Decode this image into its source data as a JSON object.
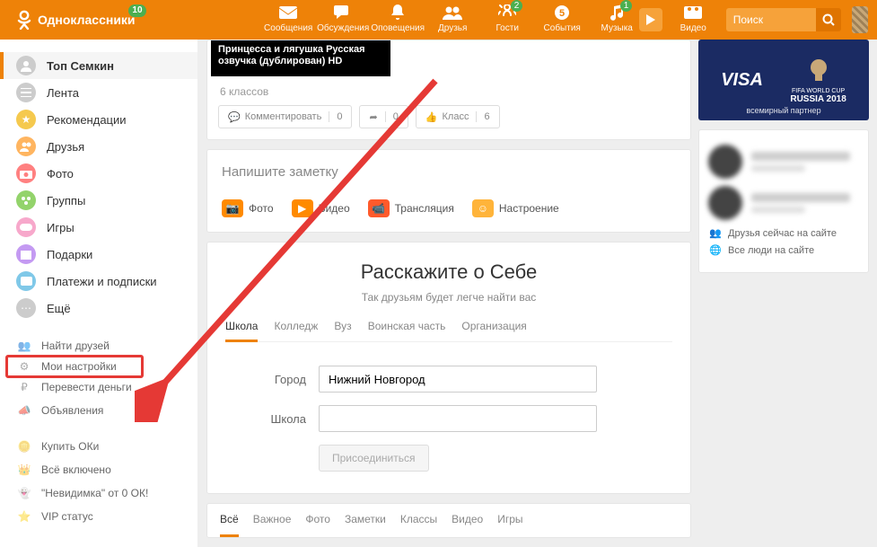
{
  "header": {
    "site": "Одноклассники",
    "notif": "10",
    "nav": [
      {
        "label": "Сообщения"
      },
      {
        "label": "Обсуждения"
      },
      {
        "label": "Оповещения"
      },
      {
        "label": "Друзья"
      },
      {
        "label": "Гости",
        "badge": "2"
      },
      {
        "label": "События"
      },
      {
        "label": "Музыка",
        "badge": "1"
      },
      {
        "label": "Видео"
      }
    ],
    "search_ph": "Поиск"
  },
  "sidebar": {
    "profile": "Топ Семкин",
    "items": [
      {
        "label": "Лента"
      },
      {
        "label": "Рекомендации"
      },
      {
        "label": "Друзья"
      },
      {
        "label": "Фото"
      },
      {
        "label": "Группы"
      },
      {
        "label": "Игры"
      },
      {
        "label": "Подарки"
      },
      {
        "label": "Платежи и подписки"
      },
      {
        "label": "Ещё"
      }
    ],
    "tools": [
      {
        "label": "Найти друзей"
      },
      {
        "label": "Мои настройки"
      },
      {
        "label": "Перевести деньги"
      },
      {
        "label": "Объявления"
      }
    ],
    "promo": [
      {
        "label": "Купить ОКи"
      },
      {
        "label": "Всё включено"
      },
      {
        "label": "\"Невидимка\" от 0 ОК!"
      },
      {
        "label": "VIP статус"
      }
    ]
  },
  "post": {
    "title": "Принцесса и лягушка Русская озвучка (дублирован) HD",
    "likes": "6 классов",
    "comment": "Комментировать",
    "comment_cnt": "0",
    "share_cnt": "0",
    "class": "Класс",
    "class_cnt": "6"
  },
  "note": {
    "heading": "Напишите заметку",
    "attach": [
      {
        "label": "Фото"
      },
      {
        "label": "Видео"
      },
      {
        "label": "Трансляция"
      },
      {
        "label": "Настроение"
      }
    ]
  },
  "about": {
    "title": "Расскажите о Себе",
    "sub": "Так друзьям будет легче найти вас",
    "tabs": [
      "Школа",
      "Колледж",
      "Вуз",
      "Воинская часть",
      "Организация"
    ],
    "city_label": "Город",
    "city_value": "Нижний Новгород",
    "school_label": "Школа",
    "school_value": "",
    "join": "Присоединиться"
  },
  "filters": [
    "Всё",
    "Важное",
    "Фото",
    "Заметки",
    "Классы",
    "Видео",
    "Игры"
  ],
  "right": {
    "ad": {
      "brand": "VISA",
      "event": "RUSSIA 2018",
      "tag": "FIFA WORLD CUP",
      "foot": "всемирный партнер"
    },
    "online": "Друзья сейчас на сайте",
    "all": "Все люди на сайте"
  }
}
